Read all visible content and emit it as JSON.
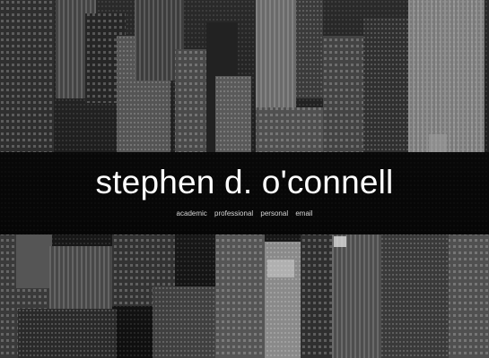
{
  "site": {
    "title": "stephen d. o'connell"
  },
  "nav": {
    "items": [
      "academic",
      "professional",
      "personal",
      "email"
    ]
  },
  "background": {
    "description_color": "#1a1a1a",
    "overlay_color": "#000000"
  }
}
